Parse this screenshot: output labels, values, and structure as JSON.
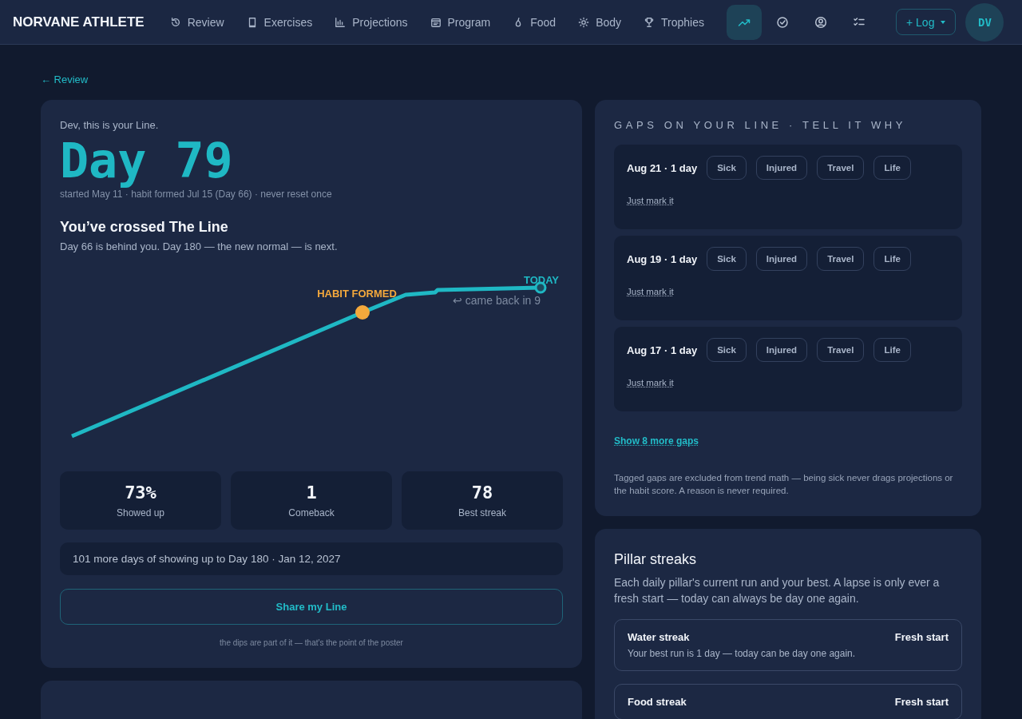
{
  "brand": "NORVANE ATHLETE",
  "nav": [
    {
      "label": "Review"
    },
    {
      "label": "Exercises"
    },
    {
      "label": "Projections"
    },
    {
      "label": "Program"
    },
    {
      "label": "Food"
    },
    {
      "label": "Body"
    },
    {
      "label": "Trophies"
    }
  ],
  "icon_buttons": [
    {
      "selected": true
    },
    {
      "selected": false
    },
    {
      "selected": false
    },
    {
      "selected": false
    }
  ],
  "log_button": {
    "label": "+ Log"
  },
  "avatar": {
    "initials": "DV"
  },
  "back_link": "← Review",
  "line_card": {
    "greeting": "Dev, this is your Line.",
    "day": "Day 79",
    "meta": "started May 11 · habit formed Jul 15 (Day 66) · never reset once",
    "heading": "You’ve crossed The Line",
    "subheading": "Day 66 is behind you. Day 180 — the new normal — is next.",
    "chart_labels": {
      "habit": "HABIT FORMED",
      "today": "TODAY",
      "comeback": "↩ came back in 9"
    },
    "stats": [
      {
        "value": "73%",
        "label": "Showed up"
      },
      {
        "value": "1",
        "label": "Comeback"
      },
      {
        "value": "78",
        "label": "Best streak"
      }
    ],
    "remaining": "101 more days of showing up to Day 180 · Jan 12, 2027",
    "share_button": "Share my Line",
    "note": "the dips are part of it — that's the point of the poster"
  },
  "gaps_card": {
    "title": "GAPS ON YOUR LINE · TELL IT WHY",
    "gaps": [
      {
        "date": "Aug 21 · 1 day",
        "reasons": [
          "Sick",
          "Injured",
          "Travel",
          "Life"
        ],
        "mark_link": "Just mark it"
      },
      {
        "date": "Aug 19 · 1 day",
        "reasons": [
          "Sick",
          "Injured",
          "Travel",
          "Life"
        ],
        "mark_link": "Just mark it"
      },
      {
        "date": "Aug 17 · 1 day",
        "reasons": [
          "Sick",
          "Injured",
          "Travel",
          "Life"
        ],
        "mark_link": "Just mark it"
      }
    ],
    "more_link": "Show 8 more gaps",
    "footnote": "Tagged gaps are excluded from trend math — being sick never drags projections or the habit score. A reason is never required."
  },
  "streaks_card": {
    "title": "Pillar streaks",
    "description": "Each daily pillar's current run and your best. A lapse is only ever a fresh start — today can always be day one again.",
    "streaks": [
      {
        "name": "Water streak",
        "status": "Fresh start",
        "detail": "Your best run is 1 day — today can be day one again."
      },
      {
        "name": "Food streak",
        "status": "Fresh start"
      }
    ]
  }
}
